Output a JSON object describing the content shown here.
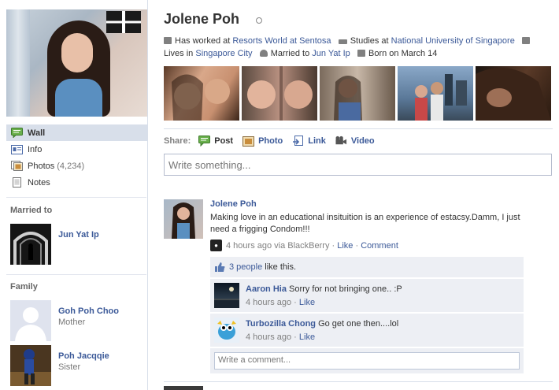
{
  "profile": {
    "name": "Jolene Poh",
    "info": {
      "worked_prefix": "Has worked at",
      "worked_at": "Resorts World at Sentosa",
      "studies_prefix": "Studies at",
      "studies_at": "National University of Singapore",
      "lives_prefix": "Lives in",
      "lives_in": "Singapore City",
      "married_prefix": "Married to",
      "married_to": "Jun Yat Ip",
      "born": "Born on March 14"
    }
  },
  "nav": {
    "items": [
      {
        "label": "Wall",
        "icon": "wall-icon",
        "active": true
      },
      {
        "label": "Info",
        "icon": "info-icon"
      },
      {
        "label": "Photos",
        "count": "(4,234)",
        "icon": "photos-icon"
      },
      {
        "label": "Notes",
        "icon": "notes-icon"
      }
    ]
  },
  "married_section": {
    "heading": "Married to",
    "person": {
      "name": "Jun Yat Ip"
    }
  },
  "family_section": {
    "heading": "Family",
    "members": [
      {
        "name": "Goh Poh Choo",
        "relation": "Mother"
      },
      {
        "name": "Poh Jacqqie",
        "relation": "Sister"
      }
    ]
  },
  "share": {
    "label": "Share:",
    "items": [
      {
        "label": "Post",
        "icon": "post-icon"
      },
      {
        "label": "Photo",
        "icon": "photo-icon"
      },
      {
        "label": "Link",
        "icon": "link-icon"
      },
      {
        "label": "Video",
        "icon": "video-icon"
      }
    ],
    "placeholder": "Write something..."
  },
  "story": {
    "author": "Jolene Poh",
    "text": "Making love in an educational insituition is an experience of estacsy.Damm, I just need a frigging Condom!!!",
    "time": "4 hours ago via BlackBerry",
    "like": "Like",
    "comment": "Comment",
    "likes_count": "3 people",
    "likes_suffix": "like this.",
    "comments": [
      {
        "author": "Aaron Hia",
        "text": "Sorry for not bringing one.. :P",
        "time": "4 hours ago",
        "like": "Like"
      },
      {
        "author": "Turbozilla Chong",
        "text": "Go get one then....lol",
        "time": "4 hours ago",
        "like": "Like"
      }
    ],
    "reply_placeholder": "Write a comment..."
  },
  "colors": {
    "link": "#3b5998",
    "active_nav": "#d8dfea",
    "ufi_bg": "#edeff4"
  }
}
